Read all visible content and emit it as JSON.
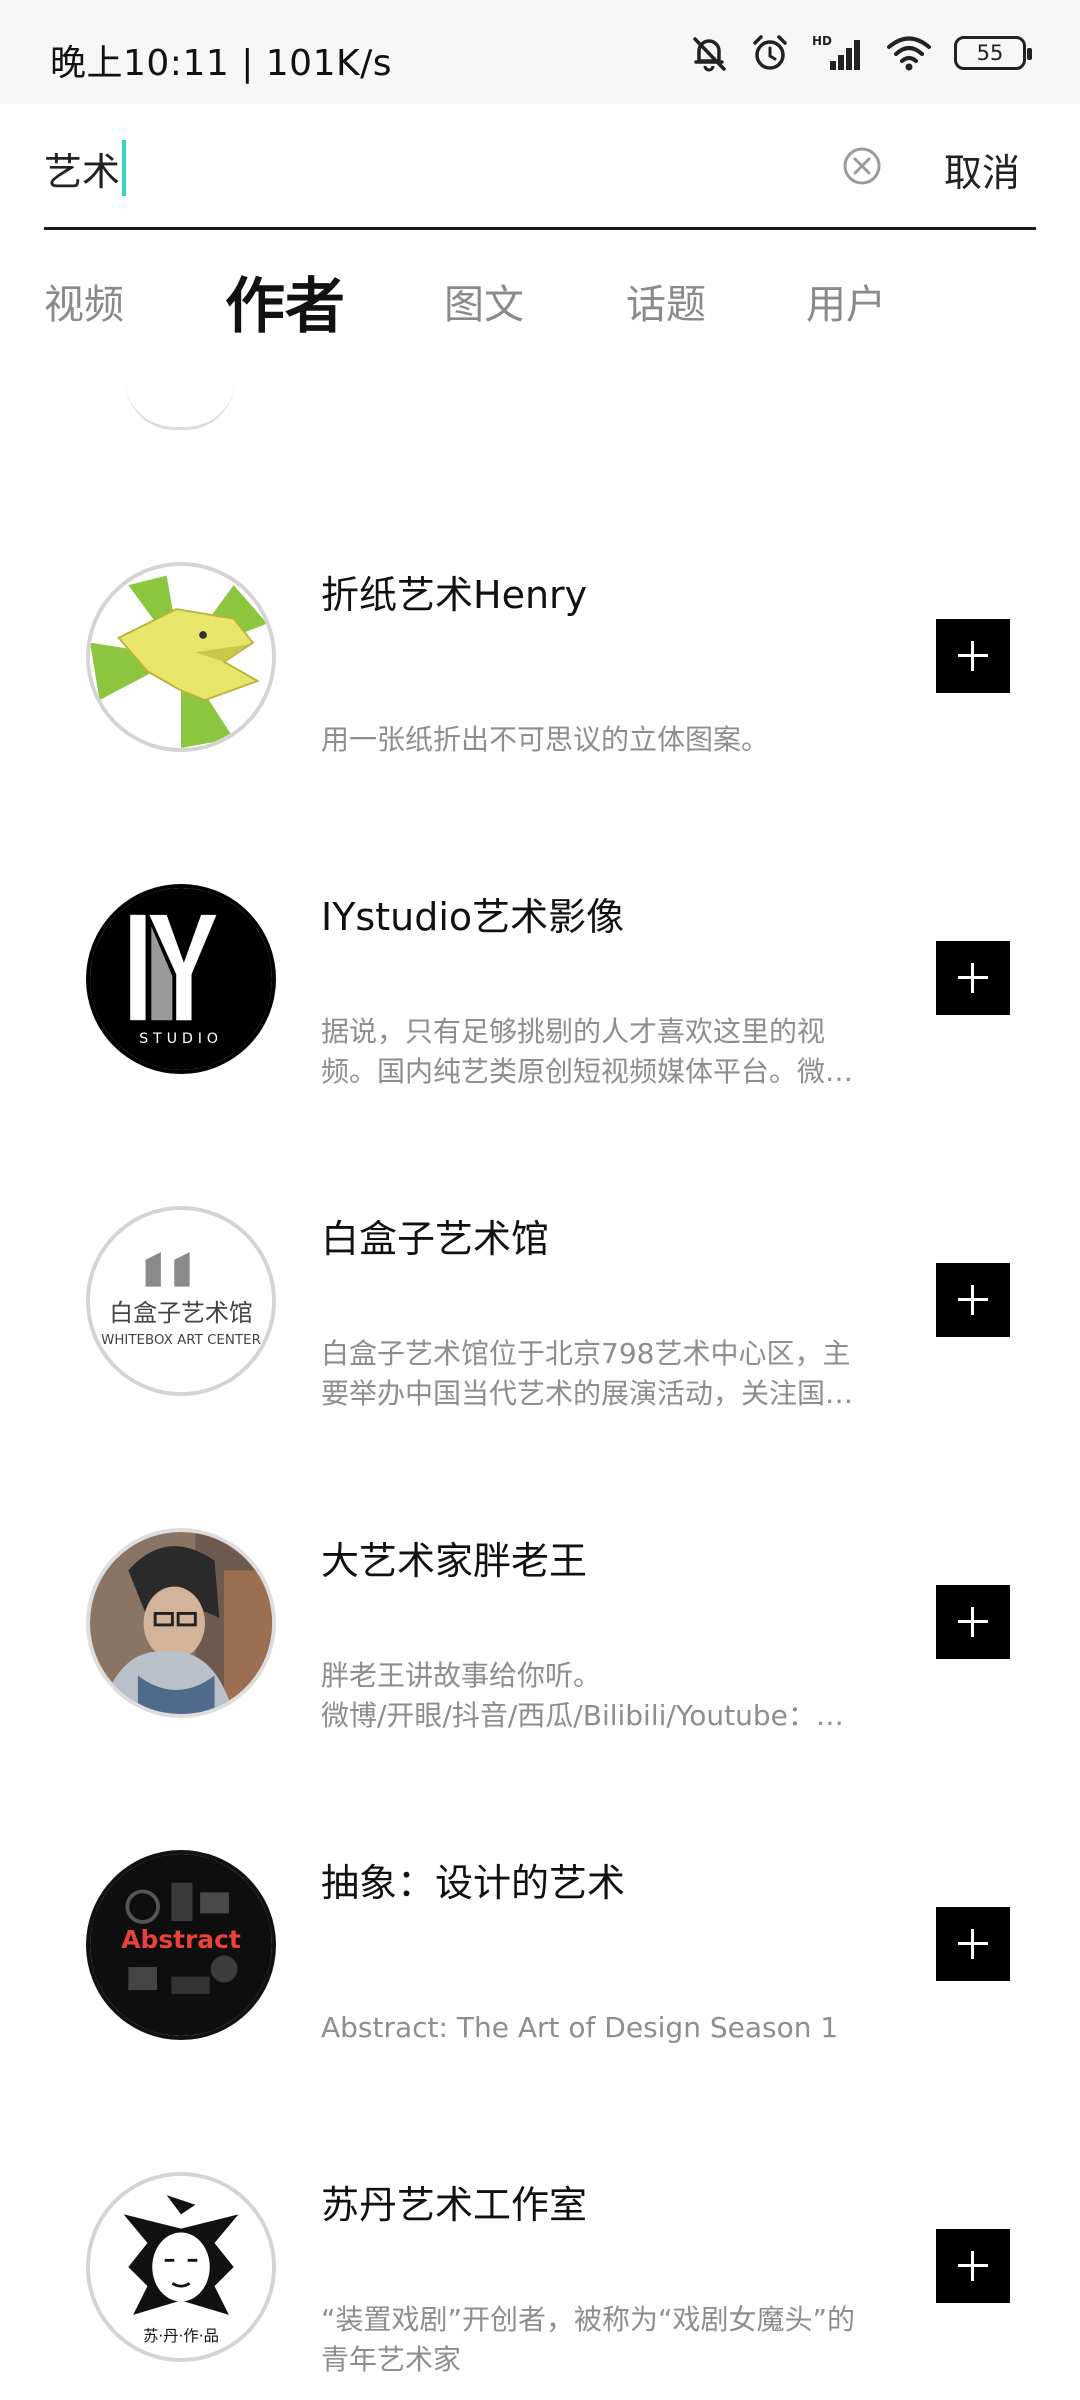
{
  "status_bar": {
    "time_text": "晚上10:11 | 101K/s",
    "battery_level": "55",
    "icons": [
      "bell-muted-icon",
      "alarm-icon",
      "hd-signal-icon",
      "wifi-icon",
      "battery-icon"
    ]
  },
  "search": {
    "query": "艺术",
    "clear_icon": "clear-circle-icon",
    "cancel_label": "取消"
  },
  "tabs": [
    {
      "label": "视频",
      "active": false
    },
    {
      "label": "作者",
      "active": true
    },
    {
      "label": "图文",
      "active": false
    },
    {
      "label": "话题",
      "active": false
    },
    {
      "label": "用户",
      "active": false
    }
  ],
  "authors": [
    {
      "name": "折纸艺术Henry",
      "desc_lines": [
        "用一张纸折出不可思议的立体图案。"
      ],
      "avatar": "origami-dinosaur-avatar",
      "follow_icon": "plus-icon"
    },
    {
      "name": "IYstudio艺术影像",
      "desc_lines": [
        "据说，只有足够挑剔的人才喜欢这里的视",
        "频。国内纯艺类原创短视频媒体平台。微…"
      ],
      "avatar": "iy-studio-logo-avatar",
      "avatar_caption": "STUDIO",
      "follow_icon": "plus-icon"
    },
    {
      "name": "白盒子艺术馆",
      "desc_lines": [
        "白盒子艺术馆位于北京798艺术中心区，主",
        "要举办中国当代艺术的展演活动，关注国…"
      ],
      "avatar": "whitebox-logo-avatar",
      "avatar_caption_cn": "白盒子艺术馆",
      "avatar_caption_en": "WHITEBOX ART CENTER",
      "follow_icon": "plus-icon"
    },
    {
      "name": "大艺术家胖老王",
      "desc_lines": [
        "胖老王讲故事给你听。",
        "微博/开眼/抖音/西瓜/Bilibili/Youtube：…"
      ],
      "avatar": "person-photo-avatar",
      "follow_icon": "plus-icon"
    },
    {
      "name": "抽象：设计的艺术",
      "desc_lines": [
        "Abstract: The Art of Design Season 1"
      ],
      "avatar": "abstract-poster-avatar",
      "avatar_caption": "Abstract",
      "follow_icon": "plus-icon"
    },
    {
      "name": "苏丹艺术工作室",
      "desc_lines": [
        "“装置戏剧”开创者，被称为“戏剧女魔头”的",
        "青年艺术家"
      ],
      "avatar": "sudan-illustration-avatar",
      "avatar_caption": "苏·丹·作·品",
      "follow_icon": "plus-icon"
    }
  ],
  "colors": {
    "caret": "#39d3c2",
    "follow_button": "#000000",
    "secondary_text": "#8e8e8e",
    "status_bar_bg": "#f7f7f7"
  }
}
